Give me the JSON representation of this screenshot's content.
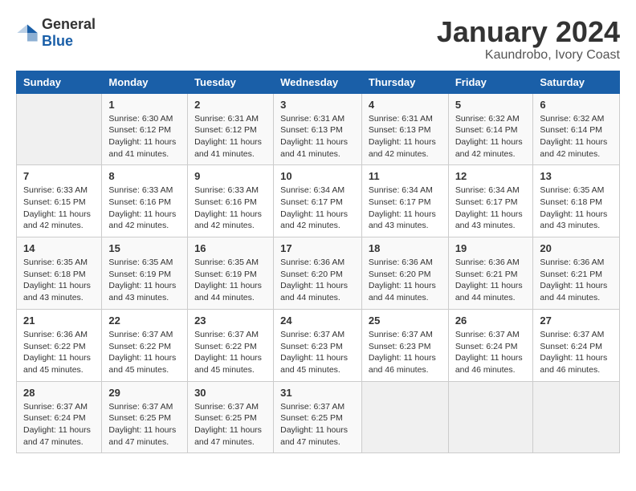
{
  "logo": {
    "general": "General",
    "blue": "Blue"
  },
  "title": "January 2024",
  "location": "Kaundrobo, Ivory Coast",
  "days_header": [
    "Sunday",
    "Monday",
    "Tuesday",
    "Wednesday",
    "Thursday",
    "Friday",
    "Saturday"
  ],
  "weeks": [
    [
      {
        "day": "",
        "sunrise": "",
        "sunset": "",
        "daylight": ""
      },
      {
        "day": "1",
        "sunrise": "Sunrise: 6:30 AM",
        "sunset": "Sunset: 6:12 PM",
        "daylight": "Daylight: 11 hours and 41 minutes."
      },
      {
        "day": "2",
        "sunrise": "Sunrise: 6:31 AM",
        "sunset": "Sunset: 6:12 PM",
        "daylight": "Daylight: 11 hours and 41 minutes."
      },
      {
        "day": "3",
        "sunrise": "Sunrise: 6:31 AM",
        "sunset": "Sunset: 6:13 PM",
        "daylight": "Daylight: 11 hours and 41 minutes."
      },
      {
        "day": "4",
        "sunrise": "Sunrise: 6:31 AM",
        "sunset": "Sunset: 6:13 PM",
        "daylight": "Daylight: 11 hours and 42 minutes."
      },
      {
        "day": "5",
        "sunrise": "Sunrise: 6:32 AM",
        "sunset": "Sunset: 6:14 PM",
        "daylight": "Daylight: 11 hours and 42 minutes."
      },
      {
        "day": "6",
        "sunrise": "Sunrise: 6:32 AM",
        "sunset": "Sunset: 6:14 PM",
        "daylight": "Daylight: 11 hours and 42 minutes."
      }
    ],
    [
      {
        "day": "7",
        "sunrise": "Sunrise: 6:33 AM",
        "sunset": "Sunset: 6:15 PM",
        "daylight": "Daylight: 11 hours and 42 minutes."
      },
      {
        "day": "8",
        "sunrise": "Sunrise: 6:33 AM",
        "sunset": "Sunset: 6:16 PM",
        "daylight": "Daylight: 11 hours and 42 minutes."
      },
      {
        "day": "9",
        "sunrise": "Sunrise: 6:33 AM",
        "sunset": "Sunset: 6:16 PM",
        "daylight": "Daylight: 11 hours and 42 minutes."
      },
      {
        "day": "10",
        "sunrise": "Sunrise: 6:34 AM",
        "sunset": "Sunset: 6:17 PM",
        "daylight": "Daylight: 11 hours and 42 minutes."
      },
      {
        "day": "11",
        "sunrise": "Sunrise: 6:34 AM",
        "sunset": "Sunset: 6:17 PM",
        "daylight": "Daylight: 11 hours and 43 minutes."
      },
      {
        "day": "12",
        "sunrise": "Sunrise: 6:34 AM",
        "sunset": "Sunset: 6:17 PM",
        "daylight": "Daylight: 11 hours and 43 minutes."
      },
      {
        "day": "13",
        "sunrise": "Sunrise: 6:35 AM",
        "sunset": "Sunset: 6:18 PM",
        "daylight": "Daylight: 11 hours and 43 minutes."
      }
    ],
    [
      {
        "day": "14",
        "sunrise": "Sunrise: 6:35 AM",
        "sunset": "Sunset: 6:18 PM",
        "daylight": "Daylight: 11 hours and 43 minutes."
      },
      {
        "day": "15",
        "sunrise": "Sunrise: 6:35 AM",
        "sunset": "Sunset: 6:19 PM",
        "daylight": "Daylight: 11 hours and 43 minutes."
      },
      {
        "day": "16",
        "sunrise": "Sunrise: 6:35 AM",
        "sunset": "Sunset: 6:19 PM",
        "daylight": "Daylight: 11 hours and 44 minutes."
      },
      {
        "day": "17",
        "sunrise": "Sunrise: 6:36 AM",
        "sunset": "Sunset: 6:20 PM",
        "daylight": "Daylight: 11 hours and 44 minutes."
      },
      {
        "day": "18",
        "sunrise": "Sunrise: 6:36 AM",
        "sunset": "Sunset: 6:20 PM",
        "daylight": "Daylight: 11 hours and 44 minutes."
      },
      {
        "day": "19",
        "sunrise": "Sunrise: 6:36 AM",
        "sunset": "Sunset: 6:21 PM",
        "daylight": "Daylight: 11 hours and 44 minutes."
      },
      {
        "day": "20",
        "sunrise": "Sunrise: 6:36 AM",
        "sunset": "Sunset: 6:21 PM",
        "daylight": "Daylight: 11 hours and 44 minutes."
      }
    ],
    [
      {
        "day": "21",
        "sunrise": "Sunrise: 6:36 AM",
        "sunset": "Sunset: 6:22 PM",
        "daylight": "Daylight: 11 hours and 45 minutes."
      },
      {
        "day": "22",
        "sunrise": "Sunrise: 6:37 AM",
        "sunset": "Sunset: 6:22 PM",
        "daylight": "Daylight: 11 hours and 45 minutes."
      },
      {
        "day": "23",
        "sunrise": "Sunrise: 6:37 AM",
        "sunset": "Sunset: 6:22 PM",
        "daylight": "Daylight: 11 hours and 45 minutes."
      },
      {
        "day": "24",
        "sunrise": "Sunrise: 6:37 AM",
        "sunset": "Sunset: 6:23 PM",
        "daylight": "Daylight: 11 hours and 45 minutes."
      },
      {
        "day": "25",
        "sunrise": "Sunrise: 6:37 AM",
        "sunset": "Sunset: 6:23 PM",
        "daylight": "Daylight: 11 hours and 46 minutes."
      },
      {
        "day": "26",
        "sunrise": "Sunrise: 6:37 AM",
        "sunset": "Sunset: 6:24 PM",
        "daylight": "Daylight: 11 hours and 46 minutes."
      },
      {
        "day": "27",
        "sunrise": "Sunrise: 6:37 AM",
        "sunset": "Sunset: 6:24 PM",
        "daylight": "Daylight: 11 hours and 46 minutes."
      }
    ],
    [
      {
        "day": "28",
        "sunrise": "Sunrise: 6:37 AM",
        "sunset": "Sunset: 6:24 PM",
        "daylight": "Daylight: 11 hours and 47 minutes."
      },
      {
        "day": "29",
        "sunrise": "Sunrise: 6:37 AM",
        "sunset": "Sunset: 6:25 PM",
        "daylight": "Daylight: 11 hours and 47 minutes."
      },
      {
        "day": "30",
        "sunrise": "Sunrise: 6:37 AM",
        "sunset": "Sunset: 6:25 PM",
        "daylight": "Daylight: 11 hours and 47 minutes."
      },
      {
        "day": "31",
        "sunrise": "Sunrise: 6:37 AM",
        "sunset": "Sunset: 6:25 PM",
        "daylight": "Daylight: 11 hours and 47 minutes."
      },
      {
        "day": "",
        "sunrise": "",
        "sunset": "",
        "daylight": ""
      },
      {
        "day": "",
        "sunrise": "",
        "sunset": "",
        "daylight": ""
      },
      {
        "day": "",
        "sunrise": "",
        "sunset": "",
        "daylight": ""
      }
    ]
  ]
}
